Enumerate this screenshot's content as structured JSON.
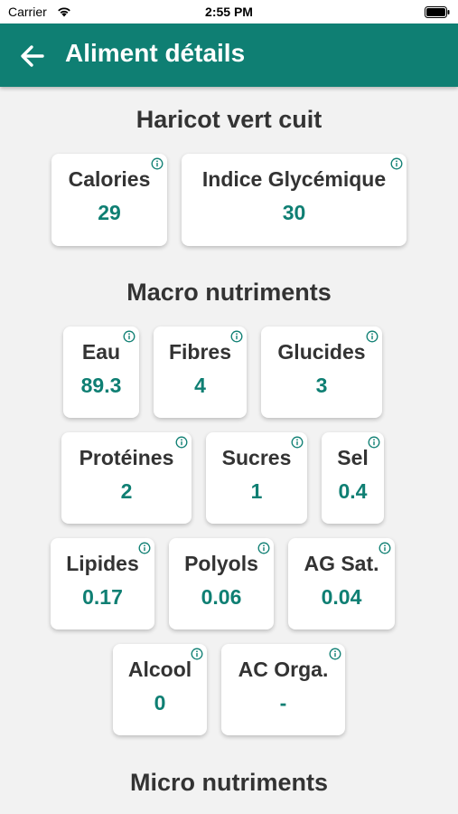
{
  "status": {
    "carrier": "Carrier",
    "time": "2:55 PM"
  },
  "header": {
    "title": "Aliment détails"
  },
  "food_name": "Haricot vert cuit",
  "summary": [
    {
      "label": "Calories",
      "value": "29"
    },
    {
      "label": "Indice Glycémique",
      "value": "30"
    }
  ],
  "macro": {
    "title": "Macro nutriments",
    "items": [
      {
        "label": "Eau",
        "value": "89.3"
      },
      {
        "label": "Fibres",
        "value": "4"
      },
      {
        "label": "Glucides",
        "value": "3"
      },
      {
        "label": "Protéines",
        "value": "2"
      },
      {
        "label": "Sucres",
        "value": "1"
      },
      {
        "label": "Sel",
        "value": "0.4"
      },
      {
        "label": "Lipides",
        "value": "0.17"
      },
      {
        "label": "Polyols",
        "value": "0.06"
      },
      {
        "label": "AG Sat.",
        "value": "0.04"
      },
      {
        "label": "Alcool",
        "value": "0"
      },
      {
        "label": "AC Orga.",
        "value": "-"
      }
    ]
  },
  "micro": {
    "title": "Micro nutriments"
  },
  "colors": {
    "accent": "#0f7f73",
    "background": "#f2f2f2"
  }
}
